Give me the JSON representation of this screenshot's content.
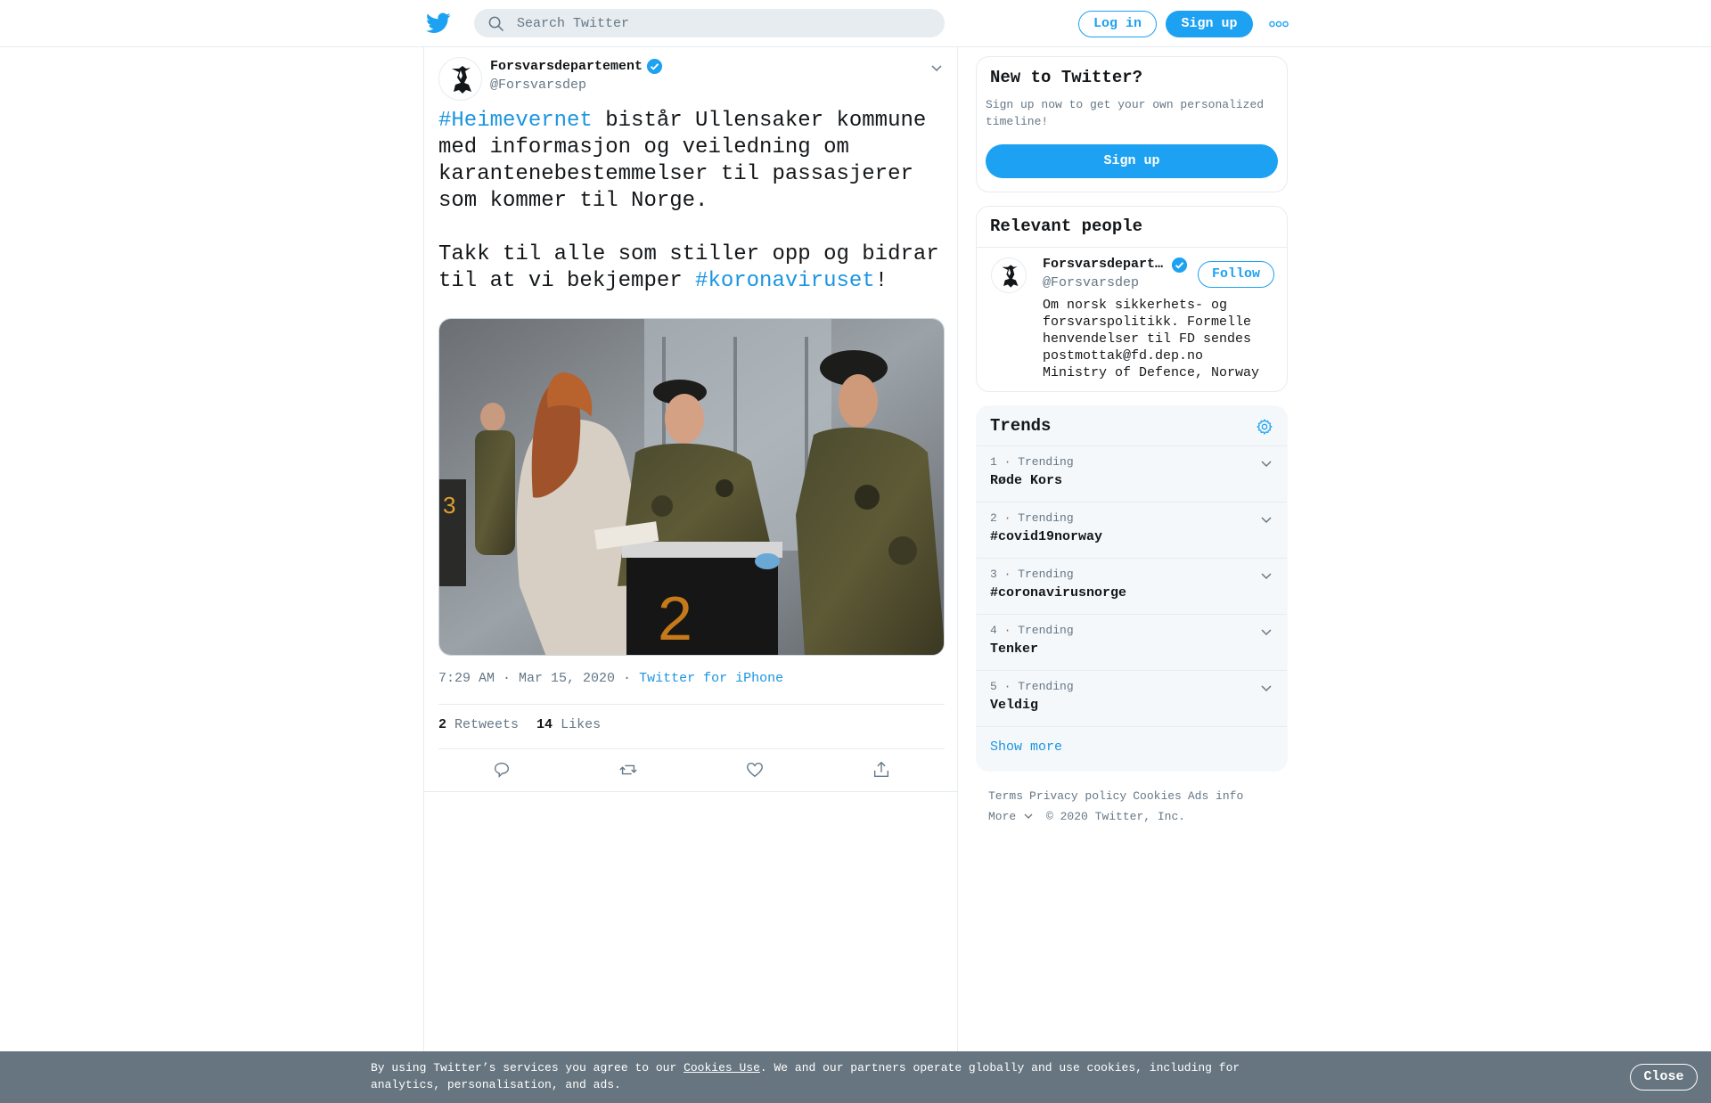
{
  "header": {
    "search_placeholder": "Search Twitter",
    "login_label": "Log in",
    "signup_label": "Sign up"
  },
  "tweet": {
    "author_name": "Forsvarsdepartement",
    "author_handle": "@Forsvarsdep",
    "text_parts": [
      {
        "text": "#Heimevernet",
        "link": true
      },
      {
        "text": " bistår Ullensaker kommune med informasjon og veiledning om karantenebestemmelser til passasjerer som kommer til Norge.\n\nTakk til alle som stiller opp og bidrar til at vi bekjemper ",
        "link": false
      },
      {
        "text": "#koronaviruset",
        "link": true
      },
      {
        "text": "!",
        "link": false
      }
    ],
    "time": "7:29 AM · Mar 15, 2020",
    "source_sep": " · ",
    "source": "Twitter for iPhone",
    "retweets_count": "2",
    "retweets_label": "Retweets",
    "likes_count": "14",
    "likes_label": "Likes"
  },
  "sidebar": {
    "new_to_twitter": {
      "title": "New to Twitter?",
      "subtitle": "Sign up now to get your own personalized timeline!",
      "signup_label": "Sign up"
    },
    "relevant_people": {
      "title": "Relevant people",
      "name": "Forsvarsdepartement",
      "handle": "@Forsvarsdep",
      "follow_label": "Follow",
      "bio": "Om norsk sikkerhets- og forsvarspolitikk. Formelle henvendelser til FD sendes postmottak@fd.dep.no\nMinistry of Defence, Norway"
    },
    "trends": {
      "title": "Trends",
      "items": [
        {
          "meta": "1 · Trending",
          "name": "Røde Kors"
        },
        {
          "meta": "2 · Trending",
          "name": "#covid19norway"
        },
        {
          "meta": "3 · Trending",
          "name": "#coronavirusnorge"
        },
        {
          "meta": "4 · Trending",
          "name": "Tenker"
        },
        {
          "meta": "5 · Trending",
          "name": "Veldig"
        }
      ],
      "show_more": "Show more"
    },
    "footer": {
      "terms": "Terms",
      "privacy": "Privacy policy",
      "cookies": "Cookies",
      "ads": "Ads info",
      "more": "More",
      "copyright": "© 2020 Twitter, Inc."
    }
  },
  "cookie_bar": {
    "text_before": "By using Twitter’s services you agree to our ",
    "link": "Cookies Use",
    "text_after": ". We and our partners operate globally and use cookies, including for analytics, personalisation, and ads.",
    "close_label": "Close"
  },
  "colors": {
    "brand_blue": "#1da1f2",
    "link_blue": "#1b95e0",
    "muted_text": "#657786",
    "cookie_bar_bg": "#66757f"
  },
  "icons": [
    "twitter-bird-icon",
    "search-icon",
    "more-dots-icon",
    "verified-icon",
    "chevron-down-icon",
    "reply-icon",
    "retweet-icon",
    "like-icon",
    "share-icon",
    "settings-gear-icon"
  ]
}
